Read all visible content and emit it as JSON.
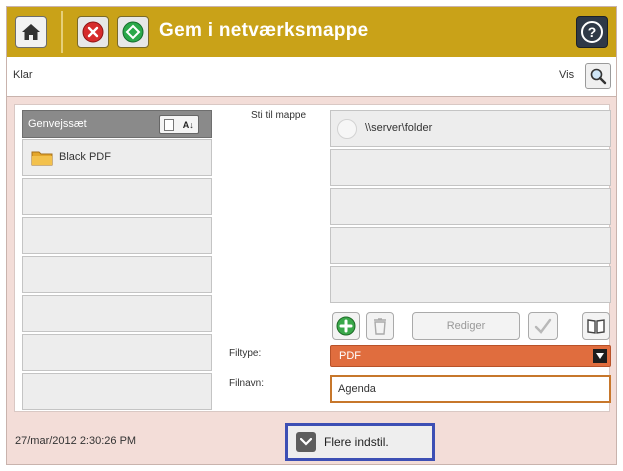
{
  "header": {
    "title": "Gem i netværksmappe",
    "home_icon": "home-icon",
    "stop_icon": "stop-icon",
    "start_icon": "start-icon",
    "help_icon": "help-icon",
    "color": "#c9a218"
  },
  "statusbar": {
    "status": "Klar",
    "view_label": "Vis",
    "view_icon": "magnifier-icon"
  },
  "shortcuts": {
    "title": "Genvejssæt",
    "items": [
      {
        "label": "Black PDF",
        "icon": "folder-icon"
      },
      {
        "label": ""
      },
      {
        "label": ""
      },
      {
        "label": ""
      },
      {
        "label": ""
      },
      {
        "label": ""
      },
      {
        "label": ""
      }
    ]
  },
  "destination": {
    "label": "Sti til mappe",
    "items": [
      {
        "label": "\\\\server\\folder"
      },
      {
        "label": ""
      },
      {
        "label": ""
      },
      {
        "label": ""
      },
      {
        "label": ""
      }
    ],
    "edit_label": "Rediger"
  },
  "filetype": {
    "label": "Filtype:",
    "value": "PDF",
    "color": "#e06d3e"
  },
  "filename": {
    "label": "Filnavn:",
    "value": "Agenda"
  },
  "footer": {
    "timestamp": "27/mar/2012 2:30:26 PM",
    "more_label": "Flere indstil."
  }
}
